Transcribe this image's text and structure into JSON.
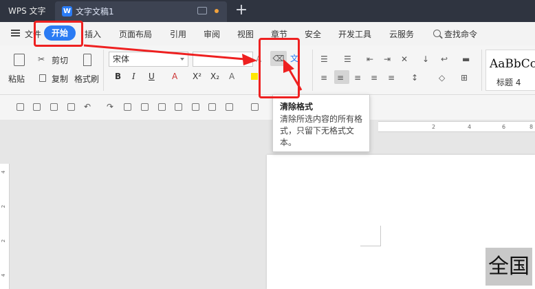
{
  "titlebar": {
    "app_name": "WPS 文字",
    "doc_title": "文字文稿1",
    "doc_icon_letter": "W",
    "new_tab": "+"
  },
  "menu": {
    "file": "文件",
    "active": "开始",
    "items": [
      "插入",
      "页面布局",
      "引用",
      "审阅",
      "视图",
      "章节",
      "安全",
      "开发工具",
      "云服务"
    ],
    "search_placeholder": "查找命令"
  },
  "ribbon": {
    "paste": "粘贴",
    "cut": "剪切",
    "copy": "复制",
    "format_painter": "格式刷",
    "font_name": "宋体",
    "font_size": "",
    "bold": "B",
    "italic": "I",
    "underline": "U",
    "font_color": "A",
    "superscript": "X²",
    "subscript": "X₂",
    "text_effect": "A",
    "style_sample": "AaBbCcI",
    "style_name": "标题 4"
  },
  "tooltip": {
    "title": "清除格式",
    "description": "清除所选内容的所有格式，只留下无格式文本。"
  },
  "ruler": {
    "h_numbers": [
      "2",
      "4",
      "6",
      "8"
    ],
    "v_numbers": [
      "4",
      "2",
      "2",
      "4"
    ]
  },
  "document": {
    "selected_text": "全国"
  },
  "annotation": {
    "color": "#ee2020"
  },
  "colors": {
    "accent": "#2b7bf3",
    "titlebar": "#2f3440"
  }
}
